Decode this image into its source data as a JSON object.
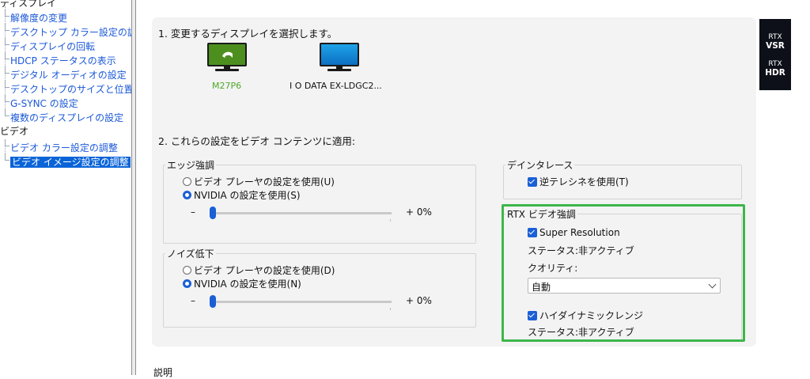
{
  "tree": {
    "display_category": "ディスプレイ",
    "display_items": [
      "解像度の変更",
      "デスクトップ カラー設定の調整",
      "ディスプレイの回転",
      "HDCP ステータスの表示",
      "デジタル オーディオの設定",
      "デスクトップのサイズと位置の調整",
      "G-SYNC の設定",
      "複数のディスプレイの設定"
    ],
    "video_category": "ビデオ",
    "video_items": [
      "ビデオ カラー設定の調整",
      "ビデオ イメージ設定の調整"
    ]
  },
  "section1": {
    "heading": "1. 変更するディスプレイを選択します。",
    "displays": [
      {
        "name": "M27P6",
        "selected": true
      },
      {
        "name": "I O DATA EX-LDGC2..."
      }
    ]
  },
  "section2": {
    "heading": "2. これらの設定をビデオ コンテンツに適用:",
    "edge": {
      "title": "エッジ強調",
      "option_player": "ビデオ プレーヤの設定を使用(U)",
      "option_nvidia": "NVIDIA の設定を使用(S)",
      "minus": "–",
      "value": "+ 0%",
      "level": 0
    },
    "noise": {
      "title": "ノイズ低下",
      "option_player": "ビデオ プレーヤの設定を使用(D)",
      "option_nvidia": "NVIDIA の設定を使用(N)",
      "minus": "–",
      "value": "+ 0%",
      "level": 0
    },
    "deinterlace": {
      "title": "デインタレース",
      "checkbox": "逆テレシネを使用(T)"
    },
    "rtx": {
      "title": "RTX ビデオ強調",
      "super_resolution": "Super Resolution",
      "sr_status": "ステータス:非アクティブ",
      "quality_label": "クオリティ:",
      "quality_value": "自動",
      "hdr": "ハイダイナミックレンジ",
      "hdr_status": "ステータス:非アクティブ"
    }
  },
  "badges": {
    "vsr_top": "RTX",
    "vsr_bottom": "VSR",
    "hdr_top": "RTX",
    "hdr_bottom": "HDR"
  },
  "footer": {
    "description_label": "説明"
  },
  "colors": {
    "accent": "#1a5fd6",
    "highlight_border": "#3db64a",
    "selection": "#0a64d8",
    "panel_bg": "#f3f3f3",
    "monitor_selected_green": "#76b900"
  }
}
